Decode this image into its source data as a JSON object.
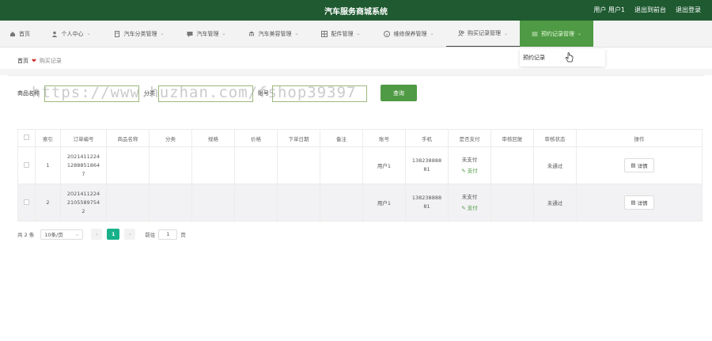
{
  "header": {
    "title": "汽车服务商城系统",
    "user": "用户 用户1",
    "back_front": "退出到前台",
    "logout": "退出登录"
  },
  "nav": {
    "items": [
      {
        "label": "首页",
        "icon": "home-icon"
      },
      {
        "label": "个人中心",
        "icon": "user-icon"
      },
      {
        "label": "汽车分类管理",
        "icon": "doc-icon"
      },
      {
        "label": "汽车管理",
        "icon": "chat-icon"
      },
      {
        "label": "汽车美容管理",
        "icon": "bank-icon"
      },
      {
        "label": "配件管理",
        "icon": "grid-icon"
      },
      {
        "label": "维修保养管理",
        "icon": "info-icon"
      },
      {
        "label": "购买记录管理",
        "icon": "people-icon"
      },
      {
        "label": "预约记录管理",
        "icon": "menu-icon"
      }
    ],
    "dropdown_item": "预约记录"
  },
  "breadcrumb": {
    "home": "首页",
    "current": "购买记录"
  },
  "search": {
    "product_label": "商品名称",
    "category_label": "分类",
    "account_label": "账号",
    "button": "查询"
  },
  "watermark": "https://www.huzhan.com/fshop39397",
  "table": {
    "headers": [
      "",
      "索引",
      "订单编号",
      "商品名称",
      "分类",
      "规格",
      "价格",
      "下单日期",
      "备注",
      "账号",
      "手机",
      "是否支付",
      "审核回复",
      "审核状态",
      "操作"
    ],
    "rows": [
      {
        "index": "1",
        "order_no": "2021411224\n1288851864\n7",
        "account": "用户1",
        "phone": "138238888\n81",
        "pay_status": "未支付",
        "pay_action": "支付",
        "audit_status": "未通过",
        "action": "详情"
      },
      {
        "index": "2",
        "order_no": "2021411224\n2105589754\n2",
        "account": "用户1",
        "phone": "138238888\n81",
        "pay_status": "未支付",
        "pay_action": "支付",
        "audit_status": "未通过",
        "action": "详情"
      }
    ]
  },
  "pagination": {
    "total": "共 2 条",
    "page_size": "10条/页",
    "prev": "‹",
    "current_page": "1",
    "next": "›",
    "goto_label": "前往",
    "goto_value": "1",
    "page_suffix": "页"
  },
  "colors": {
    "header_bg": "#1f5a31",
    "accent": "#4f9a44",
    "page_active": "#18b18a"
  }
}
